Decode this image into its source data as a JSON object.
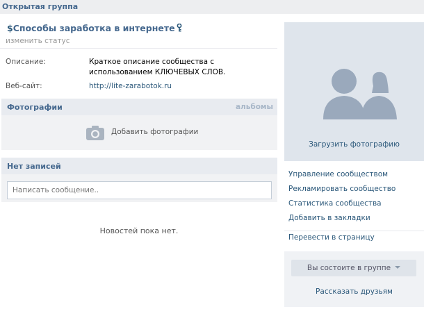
{
  "header": {
    "title": "Открытая группа"
  },
  "group": {
    "title_prefix": "$",
    "title": "Способы заработка в интернете",
    "status_link": "изменить статус"
  },
  "info": {
    "description_label": "Описание:",
    "description_value": "Краткое описание сообщества с использованием КЛЮЧЕВЫХ СЛОВ.",
    "website_label": "Веб-сайт:",
    "website_value": "http://lite-zarabotok.ru"
  },
  "photos": {
    "title": "Фотографии",
    "albums_link": "альбомы",
    "add_label": "Добавить фотографии"
  },
  "posts": {
    "title": "Нет записей",
    "input_placeholder": "Написать сообщение..",
    "empty_text": "Новостей пока нет."
  },
  "sidebar": {
    "upload_label": "Загрузить фотографию",
    "menu": [
      "Управление сообществом",
      "Рекламировать сообщество",
      "Статистика сообщества",
      "Добавить в закладки"
    ],
    "convert_label": "Перевести в страницу",
    "member_button": "Вы состоите в группе",
    "tell_friends": "Рассказать друзьям"
  },
  "colors": {
    "link": "#2b587a",
    "header_text": "#45688e",
    "avatar_bg": "#dfe5ec",
    "avatar_silhouette": "#9aa9bc"
  }
}
